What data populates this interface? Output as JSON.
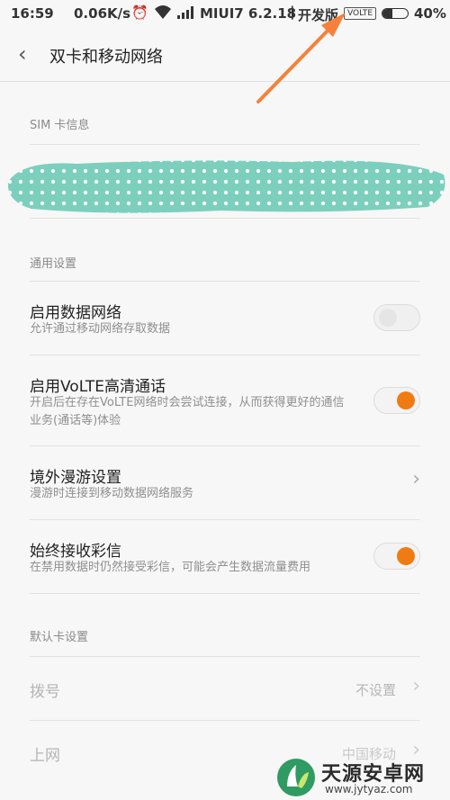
{
  "status_bar": {
    "time": "16:59",
    "speed": "0.06K/s",
    "carrier": "MIUI7 6.2.18",
    "separator": "|",
    "dev_label": "开发版",
    "volte_badge": "VOLTE",
    "battery_text": "40%",
    "battery_level": 0.4
  },
  "header": {
    "title": "双卡和移动网络"
  },
  "sim_section": {
    "label": "SIM 卡信息"
  },
  "general_section": {
    "label": "通用设置",
    "items": [
      {
        "title": "启用数据网络",
        "subtitle": "允许通过移动网络存取数据",
        "toggle": "off"
      },
      {
        "title": "启用VoLTE高清通话",
        "subtitle": "开启后在存在VoLTE网络时会尝试连接，从而获得更好的通信业务(通话等)体验",
        "toggle": "on"
      },
      {
        "title": "境外漫游设置",
        "subtitle": "漫游时连接到移动数据网络服务",
        "toggle": null
      },
      {
        "title": "始终接收彩信",
        "subtitle": "在禁用数据时仍然接受彩信，可能会产生数据流量费用",
        "toggle": "on"
      }
    ]
  },
  "default_card_section": {
    "label": "默认卡设置",
    "items": [
      {
        "title": "拨号",
        "value": "不设置"
      },
      {
        "title": "上网",
        "value": "中国移动"
      }
    ]
  },
  "watermark": {
    "site_name": "天源安卓网",
    "site_url": "www.jytyaz.com"
  },
  "colors": {
    "accent": "#f07b12",
    "annotation_arrow": "#f5813a",
    "blob": "#7dcfbd"
  },
  "icons": {
    "back": "chevron-left-icon",
    "chevron": "chevron-right-icon",
    "alarm": "alarm-icon",
    "wifi": "wifi-icon",
    "signal": "signal-icon"
  }
}
